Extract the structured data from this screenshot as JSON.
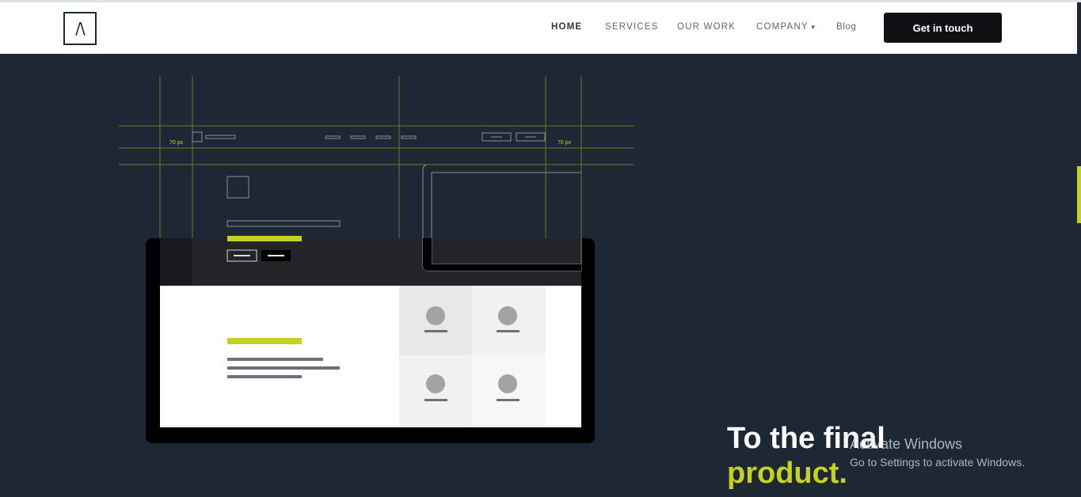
{
  "nav": {
    "logo_text": "/\\",
    "links": [
      {
        "label": "HOME",
        "active": true
      },
      {
        "label": "SERVICES",
        "active": false
      },
      {
        "label": "OUR WORK",
        "active": false
      },
      {
        "label": "COMPANY",
        "active": false,
        "has_dropdown": true
      },
      {
        "label": "Blog",
        "active": false
      }
    ],
    "cta_label": "Get in touch"
  },
  "illustration": {
    "left_margin_label": "70 px",
    "right_margin_label": "70 px"
  },
  "hero": {
    "line1": "To the final",
    "line2": "product."
  },
  "watermark": {
    "title": "Activate Windows",
    "subtitle": "Go to Settings to activate Windows."
  },
  "colors": {
    "background": "#1e2835",
    "accent": "#c6d120",
    "nav_bg": "#ffffff",
    "cta_bg": "#0f1013"
  }
}
